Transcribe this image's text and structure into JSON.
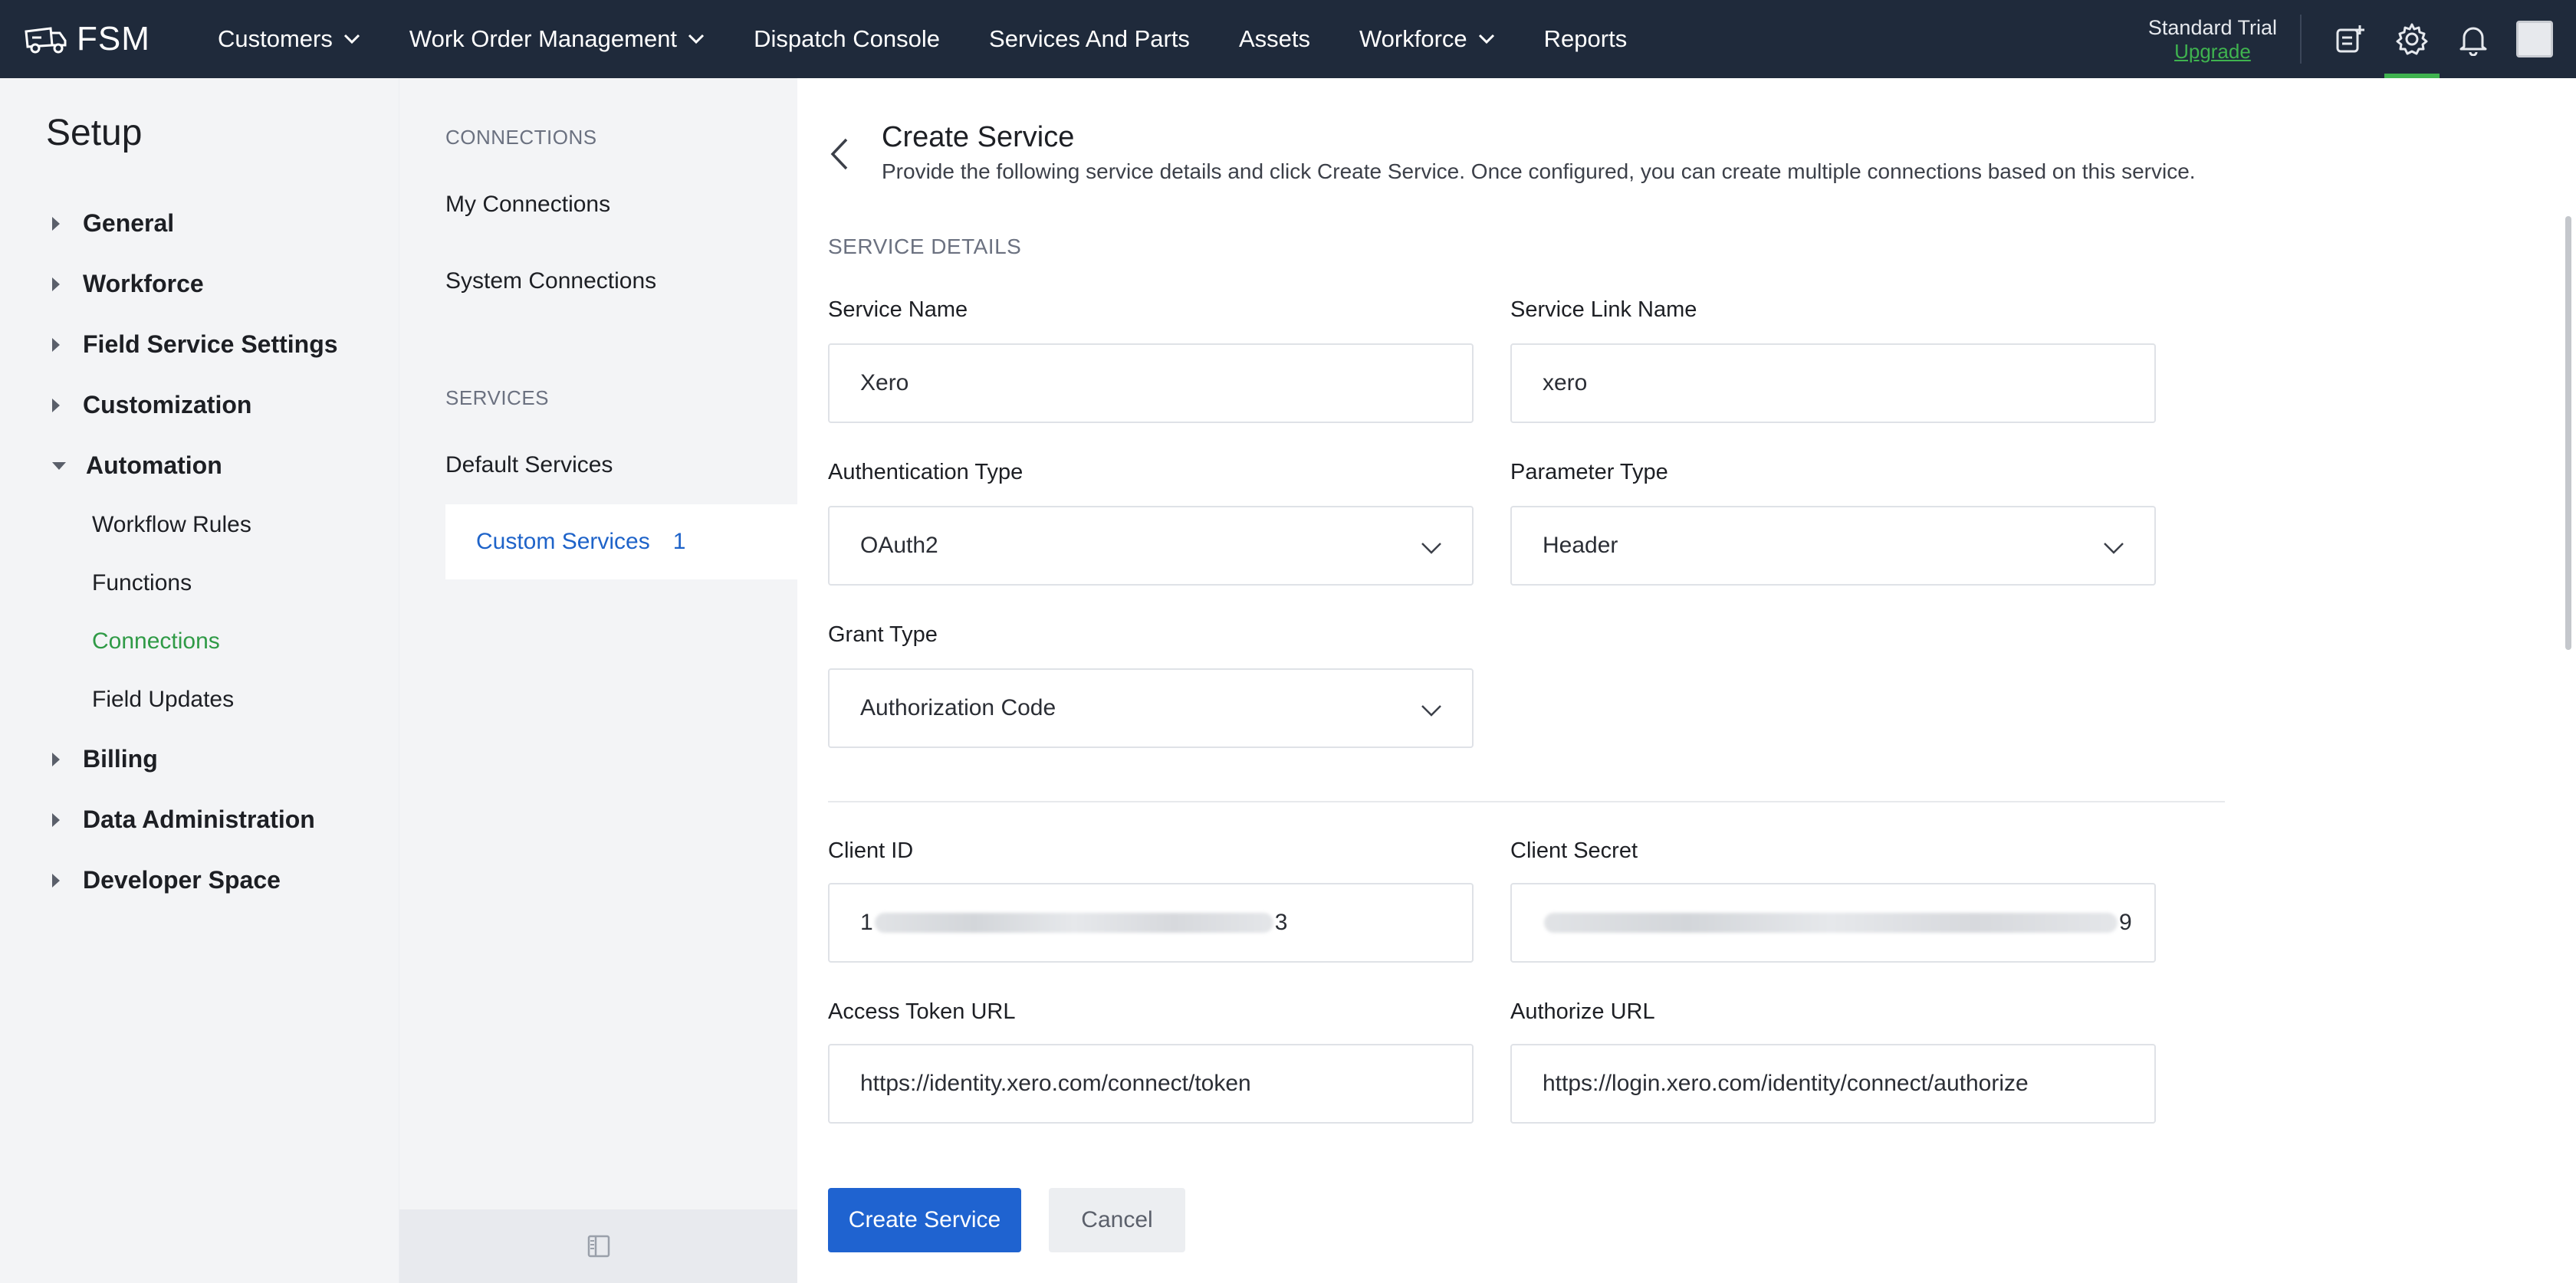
{
  "app": {
    "brand": "FSM",
    "nav": [
      {
        "label": "Customers",
        "dropdown": true
      },
      {
        "label": "Work Order Management",
        "dropdown": true
      },
      {
        "label": "Dispatch Console",
        "dropdown": false
      },
      {
        "label": "Services And Parts",
        "dropdown": false
      },
      {
        "label": "Assets",
        "dropdown": false
      },
      {
        "label": "Workforce",
        "dropdown": true
      },
      {
        "label": "Reports",
        "dropdown": false
      }
    ],
    "plan_name": "Standard Trial",
    "upgrade_label": "Upgrade"
  },
  "setup": {
    "title": "Setup",
    "items": {
      "general": "General",
      "workforce": "Workforce",
      "field_service_settings": "Field Service Settings",
      "customization": "Customization",
      "automation": "Automation",
      "billing": "Billing",
      "data_administration": "Data Administration",
      "developer_space": "Developer Space"
    },
    "automation_children": {
      "workflow_rules": "Workflow Rules",
      "functions": "Functions",
      "connections": "Connections",
      "field_updates": "Field Updates"
    }
  },
  "connections_panel": {
    "connections_heading": "CONNECTIONS",
    "my_connections": "My Connections",
    "system_connections": "System Connections",
    "services_heading": "SERVICES",
    "default_services": "Default Services",
    "custom_services": "Custom Services",
    "custom_services_count": "1"
  },
  "form": {
    "title": "Create Service",
    "description": "Provide the following service details and click Create Service. Once configured, you can create multiple connections based on this service.",
    "section_label": "SERVICE DETAILS",
    "service_name_label": "Service Name",
    "service_name_value": "Xero",
    "service_link_name_label": "Service Link Name",
    "service_link_name_value": "xero",
    "authentication_type_label": "Authentication Type",
    "authentication_type_value": "OAuth2",
    "parameter_type_label": "Parameter Type",
    "parameter_type_value": "Header",
    "grant_type_label": "Grant Type",
    "grant_type_value": "Authorization Code",
    "client_id_label": "Client ID",
    "client_id_prefix": "1",
    "client_id_suffix": "3",
    "client_secret_label": "Client Secret",
    "client_secret_suffix": "9",
    "access_token_url_label": "Access Token URL",
    "access_token_url_value": "https://identity.xero.com/connect/token",
    "authorize_url_label": "Authorize URL",
    "authorize_url_value": "https://login.xero.com/identity/connect/authorize",
    "create_button": "Create Service",
    "cancel_button": "Cancel"
  },
  "colors": {
    "topbar": "#1f2a3b",
    "accent_green": "#3fb34f",
    "link_blue": "#1e63c9",
    "primary_button": "#1f63d0"
  },
  "icons": {
    "brand": "truck-icon",
    "add_task": "add-task-icon",
    "settings": "gear-icon",
    "notifications": "bell-icon",
    "back": "chevron-left-icon",
    "collapse": "panel-collapse-icon"
  }
}
